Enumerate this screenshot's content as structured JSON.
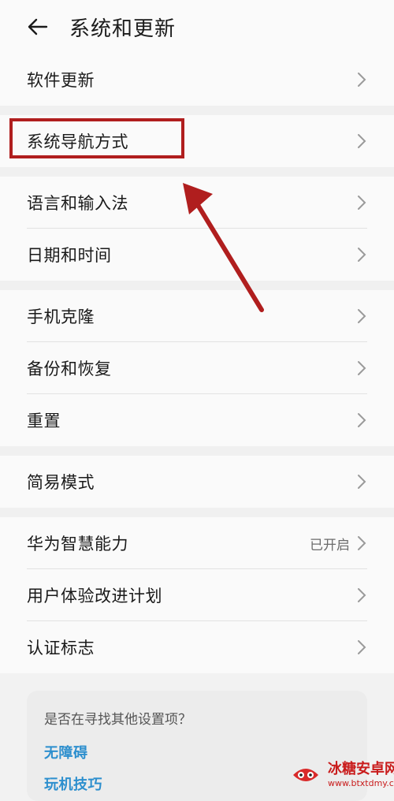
{
  "header": {
    "title": "系统和更新"
  },
  "sections": [
    {
      "items": [
        {
          "label": "软件更新"
        }
      ]
    },
    {
      "items": [
        {
          "label": "系统导航方式"
        }
      ]
    },
    {
      "items": [
        {
          "label": "语言和输入法"
        },
        {
          "label": "日期和时间"
        }
      ]
    },
    {
      "items": [
        {
          "label": "手机克隆"
        },
        {
          "label": "备份和恢复"
        },
        {
          "label": "重置"
        }
      ]
    },
    {
      "items": [
        {
          "label": "简易模式"
        }
      ]
    },
    {
      "items": [
        {
          "label": "华为智慧能力",
          "value": "已开启"
        },
        {
          "label": "用户体验改进计划"
        },
        {
          "label": "认证标志"
        }
      ]
    }
  ],
  "suggestions": {
    "question": "是否在寻找其他设置项？",
    "links": [
      "无障碍",
      "玩机技巧"
    ]
  },
  "watermark": {
    "name": "冰糖安卓网",
    "url": "www.btxtdmy.com"
  },
  "colors": {
    "highlight": "#b01e1e",
    "link": "#2d8fce",
    "background": "#f2f2f2"
  },
  "icons": {
    "back": "arrow-left-icon",
    "chevron": "chevron-right-icon"
  }
}
